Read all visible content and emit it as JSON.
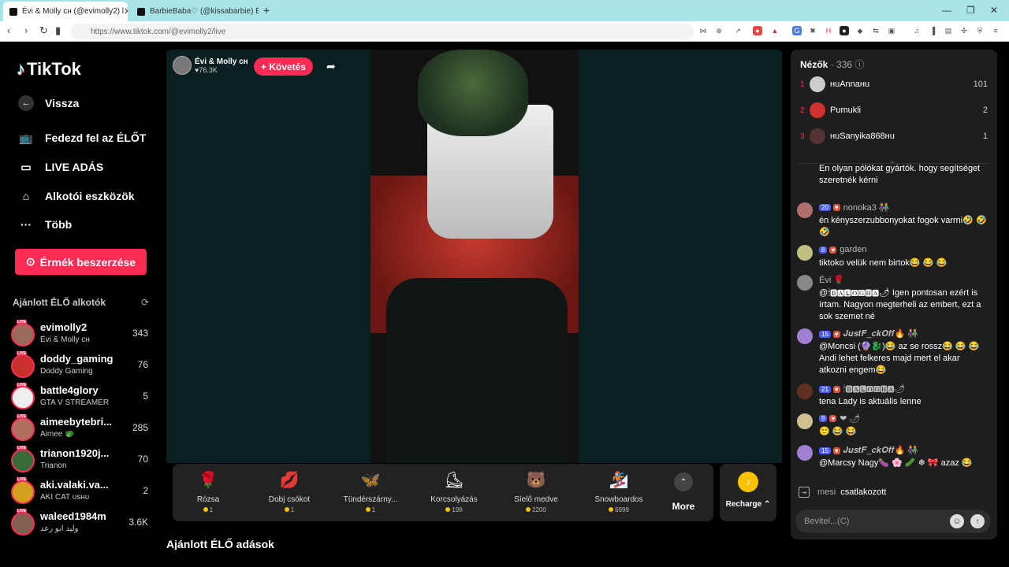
{
  "browser": {
    "tabs": [
      {
        "title": "Évi & Molly ᴄʜ (@evimolly2) l"
      },
      {
        "title": "BarbieBaba♡ (@kissabarbie) ÉLŐ ad"
      }
    ],
    "url": "https://www.tiktok.com/@evimolly2/live"
  },
  "sidebar": {
    "logo": "TikTok",
    "back": "Vissza",
    "nav": [
      "Fedezd fel az ÉLŐT",
      "LIVE ADÁS",
      "Alkotói eszközök",
      "Több"
    ],
    "coins_button": "Érmék beszerzése",
    "recommended_title": "Ajánlott ÉLŐ alkotók",
    "creators": [
      {
        "name": "evimolly2",
        "sub": "Évi & Molly ᴄʜ",
        "count": "343",
        "color": "#9a6b5a"
      },
      {
        "name": "doddy_gaming",
        "sub": "Doddy Gaming",
        "count": "76",
        "color": "#c9302c"
      },
      {
        "name": "battle4glory",
        "sub": "GTA V STREAMER",
        "count": "5",
        "color": "#eee"
      },
      {
        "name": "aimeebytebri...",
        "sub": "Aimee 🐲",
        "count": "285",
        "color": "#b07060"
      },
      {
        "name": "trianon1920j...",
        "sub": "Trianon",
        "count": "70",
        "color": "#3a6a3a"
      },
      {
        "name": "aki.valaki.va...",
        "sub": "AKI CAT ᴜsʜᴜ",
        "count": "2",
        "color": "#d4a020"
      },
      {
        "name": "waleed1984m",
        "sub": "وليد ابو رعد",
        "count": "3.6K",
        "color": "#806050"
      }
    ]
  },
  "stream": {
    "host_name": "Évi & Molly ᴄʜ",
    "host_likes": "♥76.3K",
    "follow": "+ Követés"
  },
  "gifts": [
    {
      "name": "Rózsa",
      "price": "1",
      "icon": "🌹"
    },
    {
      "name": "Dobj csókot",
      "price": "1",
      "icon": "💋"
    },
    {
      "name": "Tündérszárny...",
      "price": "1",
      "icon": "🦋"
    },
    {
      "name": "Korcsolyázás",
      "price": "199",
      "icon": "⛸"
    },
    {
      "name": "Síelő medve",
      "price": "2200",
      "icon": "🐻"
    },
    {
      "name": "Snowboardos",
      "price": "6999",
      "icon": "🏂"
    }
  ],
  "more_label": "More",
  "recharge_label": "Recharge ⌃",
  "recommended_live": "Ajánlott ÉLŐ adások",
  "viewers": {
    "title": "Nézők",
    "count": "· 336",
    "top": [
      {
        "rank": "1",
        "name": "ʜuAnnaʜu",
        "score": "101",
        "color": "#ccc"
      },
      {
        "rank": "2",
        "name": "Pumukli",
        "score": "2",
        "color": "#d03030"
      },
      {
        "rank": "3",
        "name": "ʜuSanyika868ʜu",
        "score": "1",
        "color": "#553333"
      }
    ]
  },
  "chat": [
    {
      "user": "",
      "badge": "",
      "text": "En olyan pólókat gyártók. hogy segítséget szeretnék kérni",
      "color": "#555"
    },
    {
      "user": "nonoka3 👫",
      "badge": "20",
      "text": "én kényszerzubbonyokat fogok varrni🤣 🤣 🤣",
      "color": "#b07070"
    },
    {
      "user": "garden",
      "badge": "8",
      "text": "tiktoko velük nem birtok😂 😂 😂",
      "color": "#c0c080"
    },
    {
      "user": "Évi 🌹",
      "badge": "",
      "text": "@🕯🅱🅰🅻🅾🅶🅷🅰🌶 Igen pontosan ezért is írtam. Nagyon megterheli az embert, ezt a sok szemet né",
      "color": "#888"
    },
    {
      "user": "𝑱𝒖𝒔𝒕𝑭_𝒄𝒌𝑶𝒇𝒇🔥 👫",
      "badge": "15",
      "text": "@Moncsi (🔮🐉)😂 az se rossz😂 😂 😂 Andi lehet felkeres majd mert el akar atkozni engem😂",
      "color": "#a080d0"
    },
    {
      "user": "🕯🅱🅰🅻🅾🅶🅷🅰🌶",
      "badge": "21",
      "text": "tena Lady is aktuális lenne",
      "color": "#603020"
    },
    {
      "user": "❤ 🌶",
      "badge": "9",
      "text": "🙂 😂 😂",
      "color": "#d0c090"
    },
    {
      "user": "𝑱𝒖𝒔𝒕𝑭_𝒄𝒌𝑶𝒇𝒇🔥 👫",
      "badge": "15",
      "text": "@Marcsy Nagy🍆 🌸 🥒 ❄ 🎀 azaz 😂",
      "color": "#a080d0"
    }
  ],
  "joined": {
    "name": "mesi",
    "text": "csatlakozott"
  },
  "chat_input_placeholder": "Bevitel...(C)"
}
